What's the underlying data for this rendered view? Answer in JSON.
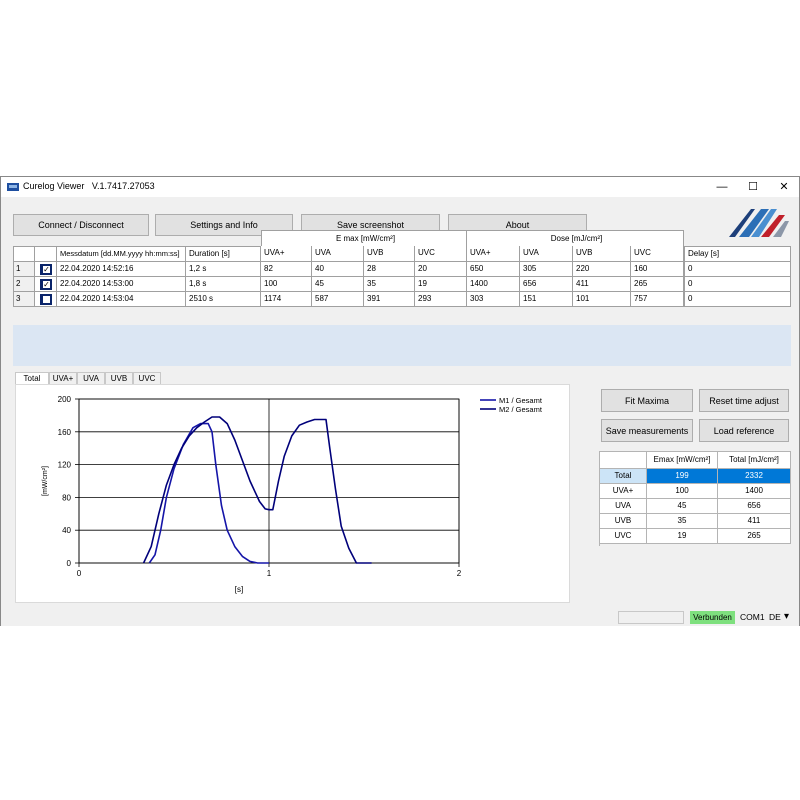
{
  "app": {
    "title": "Curelog Viewer   V.1.7417.27053",
    "minimize": "—",
    "maximize": "☐",
    "close": "✕"
  },
  "toolbar": {
    "connect": "Connect / Disconnect",
    "settings": "Settings and Info",
    "screenshot": "Save screenshot",
    "about": "About"
  },
  "grid": {
    "group_emax": "E max [mW/cm²]",
    "group_dose": "Dose [mJ/cm²]",
    "col_date": "Messdatum [dd.MM.yyyy hh:mm:ss]",
    "col_duration": "Duration [s]",
    "emax_cols": [
      "UVA+",
      "UVA",
      "UVB",
      "UVC"
    ],
    "dose_cols": [
      "UVA+",
      "UVA",
      "UVB",
      "UVC"
    ],
    "col_delay": "Delay [s]",
    "rows": [
      {
        "index": "1",
        "checked": true,
        "date": "22.04.2020  14:52:16",
        "duration": "1,2 s",
        "emax": [
          "82",
          "40",
          "28",
          "20"
        ],
        "dose": [
          "650",
          "305",
          "220",
          "160"
        ],
        "delay": "0"
      },
      {
        "index": "2",
        "checked": true,
        "date": "22.04.2020  14:53:00",
        "duration": "1,8 s",
        "emax": [
          "100",
          "45",
          "35",
          "19"
        ],
        "dose": [
          "1400",
          "656",
          "411",
          "265"
        ],
        "delay": "0"
      },
      {
        "index": "3",
        "checked": false,
        "date": "22.04.2020  14:53:04",
        "duration": "2510 s",
        "emax": [
          "1174",
          "587",
          "391",
          "293"
        ],
        "dose": [
          "303",
          "151",
          "101",
          "757"
        ],
        "delay": "0"
      }
    ]
  },
  "tabs": [
    "Total",
    "UVA+",
    "UVA",
    "UVB",
    "UVC"
  ],
  "chart_data": {
    "type": "line",
    "xlabel": "[s]",
    "ylabel": "[mW/cm²]",
    "xlim": [
      0,
      2
    ],
    "ylim": [
      0,
      200
    ],
    "xticks": [
      "0",
      "1",
      "2"
    ],
    "yticks": [
      "0",
      "40",
      "80",
      "120",
      "160",
      "200"
    ],
    "grid": true,
    "legend": "top-right",
    "series": [
      {
        "name": "M1 / Gesamt",
        "color": "#1515a8",
        "x": [
          0.37,
          0.4,
          0.43,
          0.46,
          0.5,
          0.55,
          0.6,
          0.64,
          0.68,
          0.7,
          0.72,
          0.75,
          0.78,
          0.82,
          0.86,
          0.9,
          0.94,
          0.98,
          1.0
        ],
        "y": [
          0,
          10,
          40,
          80,
          115,
          145,
          165,
          170,
          170,
          160,
          120,
          70,
          40,
          20,
          8,
          2,
          0,
          0,
          0
        ]
      },
      {
        "name": "M2 / Gesamt",
        "color": "#00007a",
        "x": [
          0.34,
          0.38,
          0.42,
          0.46,
          0.5,
          0.54,
          0.58,
          0.62,
          0.66,
          0.7,
          0.74,
          0.78,
          0.82,
          0.86,
          0.9,
          0.93,
          0.95,
          0.98,
          1.0,
          1.02,
          1.05,
          1.08,
          1.12,
          1.16,
          1.2,
          1.24,
          1.28,
          1.3,
          1.32,
          1.35,
          1.38,
          1.42,
          1.46,
          1.5,
          1.54
        ],
        "y": [
          0,
          20,
          60,
          95,
          120,
          140,
          155,
          165,
          172,
          178,
          178,
          170,
          150,
          125,
          100,
          85,
          75,
          66,
          65,
          65,
          100,
          130,
          155,
          168,
          172,
          175,
          175,
          175,
          140,
          90,
          45,
          18,
          0,
          0,
          0
        ]
      }
    ]
  },
  "actions": {
    "fit": "Fit Maxima",
    "reset": "Reset time adjust",
    "save": "Save measurements",
    "load": "Load reference"
  },
  "summary": {
    "col_emax": "Emax [mW/cm²]",
    "col_total": "Total [mJ/cm²]",
    "rows": [
      {
        "label": "Total",
        "emax": "199",
        "total": "2332",
        "selected": true
      },
      {
        "label": "UVA+",
        "emax": "100",
        "total": "1400"
      },
      {
        "label": "UVA",
        "emax": "45",
        "total": "656"
      },
      {
        "label": "UVB",
        "emax": "35",
        "total": "411"
      },
      {
        "label": "UVC",
        "emax": "19",
        "total": "265"
      }
    ]
  },
  "status": {
    "connected": "Verbunden",
    "port": "COM1",
    "lang": "DE",
    "dropdown": "▾"
  }
}
